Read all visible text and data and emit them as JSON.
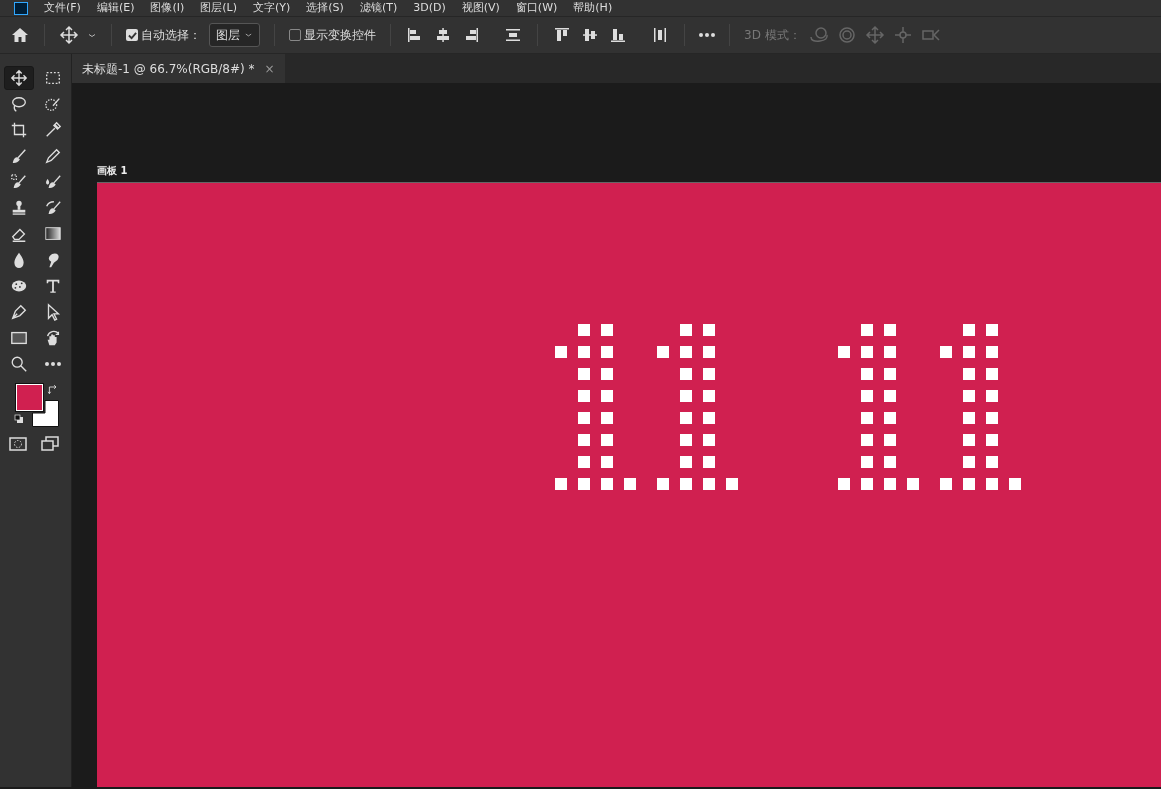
{
  "menu_bar": {
    "items": [
      "文件(F)",
      "编辑(E)",
      "图像(I)",
      "图层(L)",
      "文字(Y)",
      "选择(S)",
      "滤镜(T)",
      "3D(D)",
      "视图(V)",
      "窗口(W)",
      "帮助(H)"
    ]
  },
  "options_bar": {
    "auto_select": {
      "label": "自动选择：",
      "checked": true
    },
    "target": {
      "value": "图层"
    },
    "show_transform": {
      "label": "显示变换控件",
      "checked": false
    },
    "mode_3d": {
      "label": "3D 模式：",
      "disabled": true
    }
  },
  "tabs": [
    {
      "label": "未标题-1 @ 66.7%(RGB/8#) *",
      "selected": true,
      "close": "×"
    }
  ],
  "tools": [
    {
      "kind": "move",
      "selected": true
    },
    {
      "kind": "marquee",
      "selected": false
    },
    {
      "kind": "lasso",
      "selected": false
    },
    {
      "kind": "quick-select",
      "selected": false
    },
    {
      "kind": "crop",
      "selected": false
    },
    {
      "kind": "eyedropper",
      "selected": false
    },
    {
      "kind": "brush",
      "selected": false
    },
    {
      "kind": "pencil",
      "selected": false
    },
    {
      "kind": "healing",
      "selected": false
    },
    {
      "kind": "mixer",
      "selected": false
    },
    {
      "kind": "stamp",
      "selected": false
    },
    {
      "kind": "history",
      "selected": false
    },
    {
      "kind": "eraser",
      "selected": false
    },
    {
      "kind": "gradient",
      "selected": false
    },
    {
      "kind": "blur",
      "selected": false
    },
    {
      "kind": "smudge",
      "selected": false
    },
    {
      "kind": "sponge",
      "selected": false
    },
    {
      "kind": "type",
      "selected": false
    },
    {
      "kind": "pen",
      "selected": false
    },
    {
      "kind": "select",
      "selected": false
    },
    {
      "kind": "rectangle",
      "selected": false
    },
    {
      "kind": "rotate-view",
      "selected": false
    },
    {
      "kind": "zoom",
      "selected": false
    },
    {
      "kind": "more",
      "selected": false
    }
  ],
  "swatches": [
    {
      "kind": "foreground",
      "color": "#d02050"
    },
    {
      "kind": "background",
      "color": "#ffffff"
    }
  ],
  "artboard": {
    "label": "画板 1",
    "color": "#d02050"
  }
}
